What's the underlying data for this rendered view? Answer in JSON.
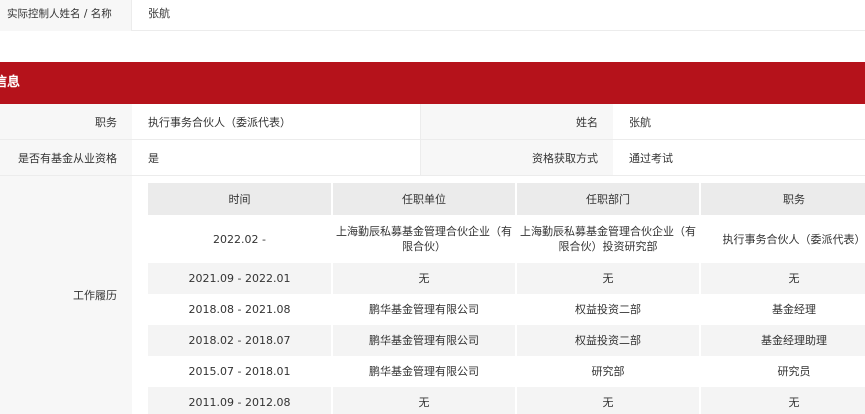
{
  "controller": {
    "label": "实际控制人姓名 / 名称",
    "value": "张航"
  },
  "section": {
    "title": "信息"
  },
  "info": {
    "row1": {
      "position_label": "职务",
      "position_value": "执行事务合伙人（委派代表）",
      "name_label": "姓名",
      "name_value": "张航"
    },
    "row2": {
      "qualified_label": "是否有基金从业资格",
      "qualified_value": "是",
      "method_label": "资格获取方式",
      "method_value": "通过考试"
    }
  },
  "history": {
    "label": "工作履历",
    "headers": [
      "时间",
      "任职单位",
      "任职部门",
      "职务"
    ],
    "rows": [
      {
        "time": "2022.02 -",
        "company": "上海勤辰私募基金管理合伙企业（有限合伙）",
        "department": "上海勤辰私募基金管理合伙企业（有限合伙）投资研究部",
        "title": "执行事务合伙人（委派代表）"
      },
      {
        "time": "2021.09 - 2022.01",
        "company": "无",
        "department": "无",
        "title": "无"
      },
      {
        "time": "2018.08 - 2021.08",
        "company": "鹏华基金管理有限公司",
        "department": "权益投资二部",
        "title": "基金经理"
      },
      {
        "time": "2018.02 - 2018.07",
        "company": "鹏华基金管理有限公司",
        "department": "权益投资二部",
        "title": "基金经理助理"
      },
      {
        "time": "2015.07 - 2018.01",
        "company": "鹏华基金管理有限公司",
        "department": "研究部",
        "title": "研究员"
      },
      {
        "time": "2011.09 - 2012.08",
        "company": "无",
        "department": "无",
        "title": "无"
      }
    ]
  }
}
